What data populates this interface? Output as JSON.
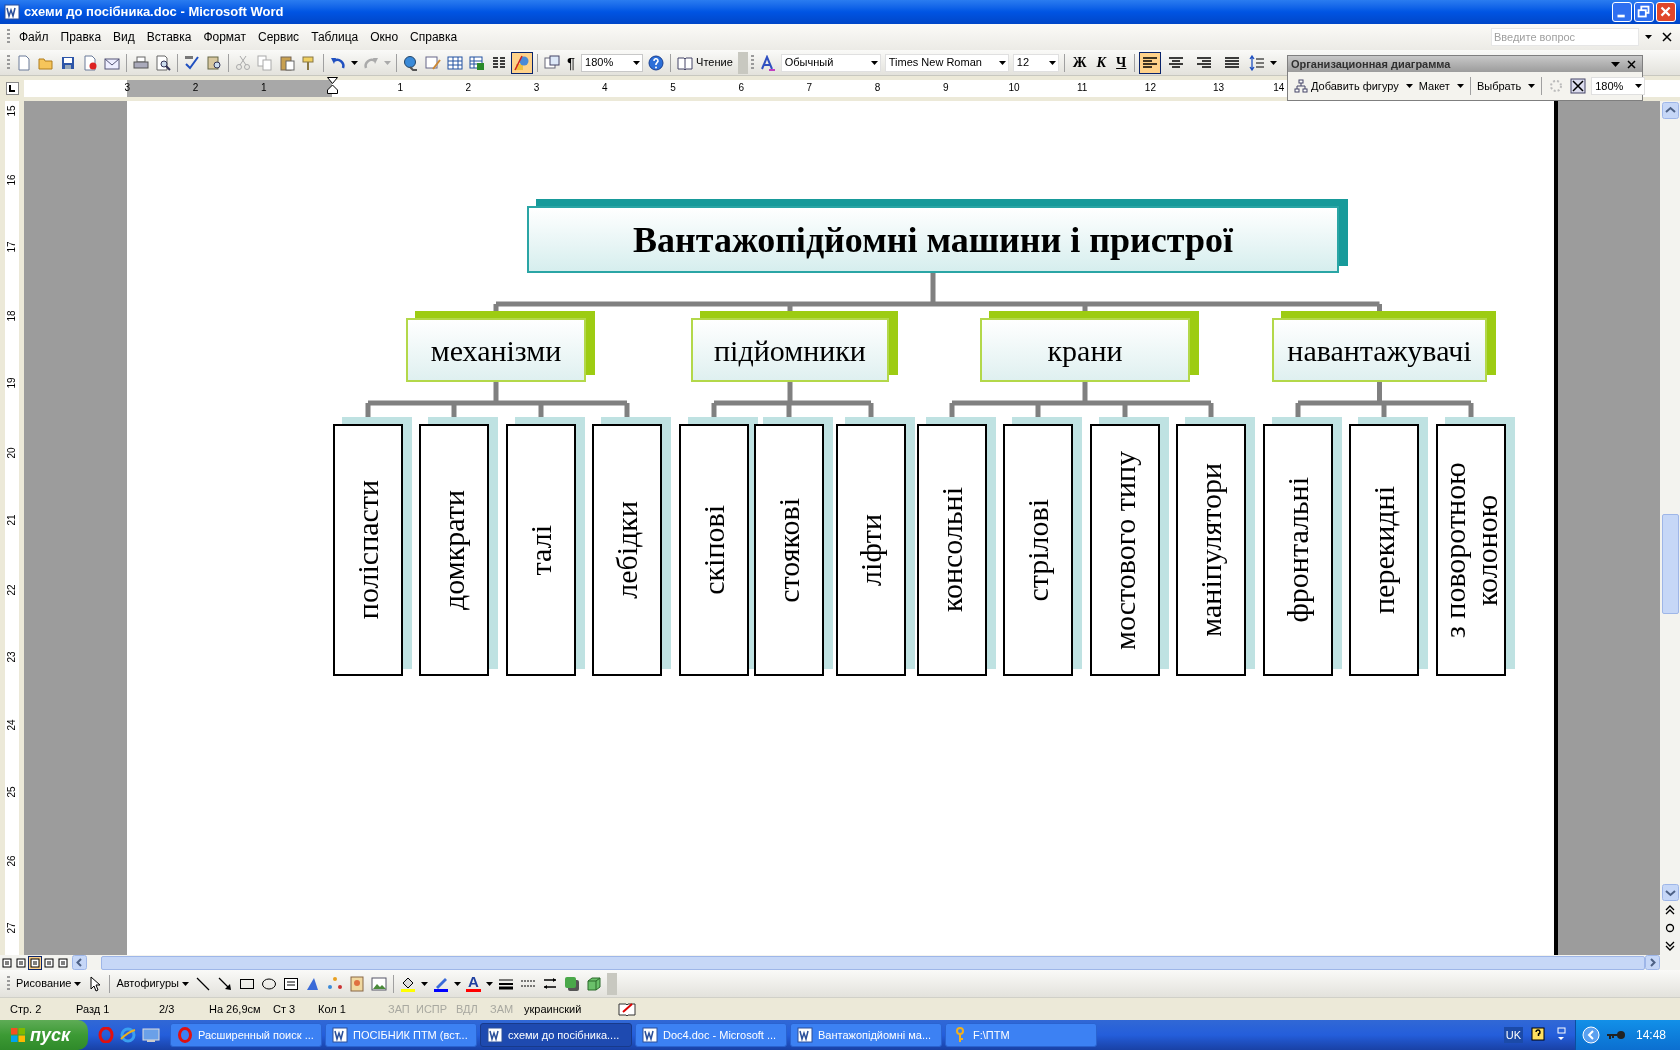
{
  "window": {
    "title": "схеми до посібника.doc - Microsoft Word"
  },
  "menu": [
    "Файл",
    "Правка",
    "Вид",
    "Вставка",
    "Формат",
    "Сервис",
    "Таблица",
    "Окно",
    "Справка"
  ],
  "help_box": {
    "placeholder": "Введите вопрос"
  },
  "standard_toolbar": {
    "drawing_pressed": true,
    "show_marks": "¶",
    "zoom": "180%",
    "reading": "Чтение"
  },
  "formatting_toolbar": {
    "style": "Обычный",
    "font": "Times New Roman",
    "size": "12",
    "bold": "Ж",
    "italic": "К",
    "underline": "Ч",
    "align": [
      {
        "selected": true
      },
      {
        "selected": false
      },
      {
        "selected": false
      },
      {
        "selected": false
      }
    ]
  },
  "ruler": {
    "left_numbers": [
      "3",
      "2",
      "1"
    ],
    "numbers": [
      "1",
      "2",
      "3",
      "4",
      "5",
      "6",
      "7",
      "8",
      "9",
      "10",
      "11",
      "12",
      "13",
      "14"
    ]
  },
  "vertical_ruler": {
    "numbers": [
      "15",
      "16",
      "17",
      "18",
      "19",
      "20",
      "21",
      "22",
      "23",
      "24",
      "25",
      "26",
      "27"
    ]
  },
  "org_chart_toolbar": {
    "title": "Организационная диаграмма",
    "buttons": [
      "Добавить фигуру",
      "Макет",
      "Выбрать"
    ],
    "zoom": "180%"
  },
  "diagram": {
    "root": {
      "label": "Вантажопідйомні машини і пристрої",
      "children": [
        {
          "label": "механізми",
          "children": [
            {
              "label": "поліспасти"
            },
            {
              "label": "домкрати"
            },
            {
              "label": "талі"
            },
            {
              "label": "лебідки"
            }
          ]
        },
        {
          "label": "підйомники",
          "children": [
            {
              "label": "скіпові"
            },
            {
              "label": "стоякові"
            },
            {
              "label": "ліфти"
            }
          ]
        },
        {
          "label": "крани",
          "children": [
            {
              "label": "консольні"
            },
            {
              "label": "стрілові"
            },
            {
              "label": "мостового типу"
            },
            {
              "label": "маніпулятори"
            }
          ]
        },
        {
          "label": "навантажувачі",
          "children": [
            {
              "label": "фронтальні"
            },
            {
              "label": "перекидні"
            },
            {
              "label": "з поворотною колоною"
            }
          ]
        }
      ]
    }
  },
  "view_buttons": [
    {
      "selected": false
    },
    {
      "selected": false
    },
    {
      "selected": true
    },
    {
      "selected": false
    },
    {
      "selected": false
    }
  ],
  "drawing_toolbar": {
    "draw": "Рисование",
    "autoshapes": "Автофигуры",
    "font_color_glyph": "A"
  },
  "status_bar": [
    {
      "text": "Стр. 2",
      "disabled": false
    },
    {
      "text": "Разд 1",
      "disabled": false
    },
    {
      "text": "2/3",
      "disabled": false
    },
    {
      "text": "На 26,9см",
      "disabled": false
    },
    {
      "text": "Ст 3",
      "disabled": false
    },
    {
      "text": "Кол 1",
      "disabled": false
    },
    {
      "text": "ЗАП",
      "disabled": true
    },
    {
      "text": "ИСПР",
      "disabled": true
    },
    {
      "text": "ВДЛ",
      "disabled": true
    },
    {
      "text": "ЗАМ",
      "disabled": true
    },
    {
      "text": "украинский",
      "disabled": false
    }
  ],
  "taskbar": {
    "start": "пуск",
    "tasks": [
      {
        "label": "Расширенный поиск ...",
        "kind": "browser",
        "selected": false
      },
      {
        "label": "ПОСІБНИК ПТМ (вст...",
        "kind": "document",
        "selected": false
      },
      {
        "label": "схеми до посібника....",
        "kind": "document",
        "selected": true
      },
      {
        "label": "Doc4.doc - Microsoft ...",
        "kind": "document",
        "selected": false
      },
      {
        "label": "Вантажопідйомні ма...",
        "kind": "document",
        "selected": false
      },
      {
        "label": "F:\\ПТМ",
        "kind": "folder",
        "selected": false
      }
    ],
    "language": "UK",
    "time": "14:48"
  }
}
